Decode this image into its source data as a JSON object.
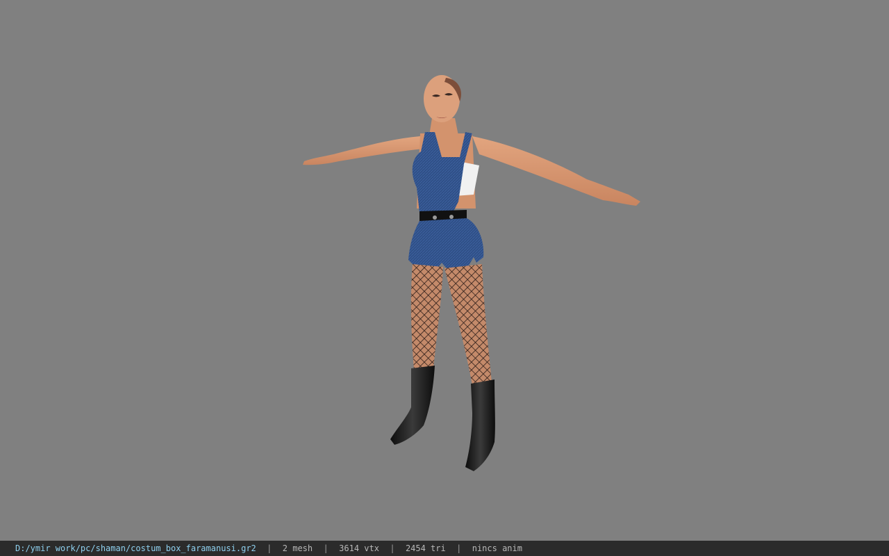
{
  "viewer": {
    "background_color": "#808080",
    "model_subject": "female character model in T-pose wearing denim romper, fishnet stockings and black boots"
  },
  "status_bar": {
    "file_path": "D:/ymir work/pc/shaman/costum_box_faramanusi.gr2",
    "mesh_count": "2 mesh",
    "vertex_count": "3614 vtx",
    "triangle_count": "2454 tri",
    "animation_status": "nincs anim",
    "separator": "|"
  },
  "colors": {
    "status_bar_bg": "#2b2b2b",
    "status_text": "#b9b9b9",
    "path_text": "#8fd1f0",
    "skin": "#d99a72",
    "denim": "#2f4f86",
    "boots": "#1a1a1a"
  }
}
